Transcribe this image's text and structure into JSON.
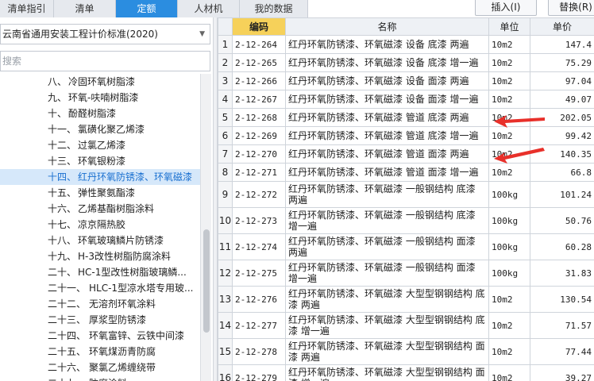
{
  "tabs": [
    {
      "label": "清单指引"
    },
    {
      "label": "清单"
    },
    {
      "label": "定额"
    },
    {
      "label": "人材机"
    },
    {
      "label": "我的数据"
    }
  ],
  "toolbar": {
    "insert_label": "插入(I)",
    "replace_label": "替换(R)"
  },
  "left": {
    "standard": "云南省通用安装工程计价标准(2020)",
    "search_placeholder": "搜索",
    "tree": [
      {
        "num": "八、",
        "label": "冷固环氧树脂漆"
      },
      {
        "num": "九、",
        "label": "环氧-呋喃树脂漆"
      },
      {
        "num": "十、",
        "label": "酚醛树脂漆"
      },
      {
        "num": "十一、",
        "label": "氯磺化聚乙烯漆"
      },
      {
        "num": "十二、",
        "label": "过氯乙烯漆"
      },
      {
        "num": "十三、",
        "label": "环氧银粉漆"
      },
      {
        "num": "十四、",
        "label": "红丹环氧防锈漆、环氧磁漆"
      },
      {
        "num": "十五、",
        "label": "弹性聚氨酯漆"
      },
      {
        "num": "十六、",
        "label": "乙烯基酯树脂涂料"
      },
      {
        "num": "十七、",
        "label": "凉京隔热胶"
      },
      {
        "num": "十八、",
        "label": "环氧玻璃鳞片防锈漆"
      },
      {
        "num": "十九、",
        "label": "H-3改性树脂防腐涂料"
      },
      {
        "num": "二十、",
        "label": "HC-1型改性树脂玻璃鳞..."
      },
      {
        "num": "二十一、",
        "label": "HLC-1型凉水塔专用玻..."
      },
      {
        "num": "二十二、",
        "label": "无溶剂环氧涂料"
      },
      {
        "num": "二十三、",
        "label": "厚浆型防锈漆"
      },
      {
        "num": "二十四、",
        "label": "环氧富锌、云铁中间漆"
      },
      {
        "num": "二十五、",
        "label": "环氧煤沥青防腐"
      },
      {
        "num": "二十六、",
        "label": "聚氯乙烯缠绕带"
      },
      {
        "num": "二十七、",
        "label": "防腐涂料..."
      }
    ]
  },
  "grid": {
    "headers": {
      "code": "编码",
      "name": "名称",
      "unit": "单位",
      "price": "单价"
    },
    "rows": [
      {
        "idx": "1",
        "code": "2-12-264",
        "name": "红丹环氧防锈漆、环氧磁漆 设备 底漆 两遍",
        "unit": "10m2",
        "price": "147.4"
      },
      {
        "idx": "2",
        "code": "2-12-265",
        "name": "红丹环氧防锈漆、环氧磁漆 设备 底漆 增一遍",
        "unit": "10m2",
        "price": "75.29"
      },
      {
        "idx": "3",
        "code": "2-12-266",
        "name": "红丹环氧防锈漆、环氧磁漆 设备 面漆 两遍",
        "unit": "10m2",
        "price": "97.04"
      },
      {
        "idx": "4",
        "code": "2-12-267",
        "name": "红丹环氧防锈漆、环氧磁漆 设备 面漆 增一遍",
        "unit": "10m2",
        "price": "49.07"
      },
      {
        "idx": "5",
        "code": "2-12-268",
        "name": "红丹环氧防锈漆、环氧磁漆 管道 底漆 两遍",
        "unit": "10m2",
        "price": "202.05"
      },
      {
        "idx": "6",
        "code": "2-12-269",
        "name": "红丹环氧防锈漆、环氧磁漆 管道 底漆 增一遍",
        "unit": "10m2",
        "price": "99.42"
      },
      {
        "idx": "7",
        "code": "2-12-270",
        "name": "红丹环氧防锈漆、环氧磁漆 管道 面漆 两遍",
        "unit": "10m2",
        "price": "140.35"
      },
      {
        "idx": "8",
        "code": "2-12-271",
        "name": "红丹环氧防锈漆、环氧磁漆 管道 面漆 增一遍",
        "unit": "10m2",
        "price": "66.8"
      },
      {
        "idx": "9",
        "code": "2-12-272",
        "name": "红丹环氧防锈漆、环氧磁漆 一般钢结构 底漆 两遍",
        "unit": "100kg",
        "price": "101.24"
      },
      {
        "idx": "10",
        "code": "2-12-273",
        "name": "红丹环氧防锈漆、环氧磁漆 一般钢结构 底漆 增一遍",
        "unit": "100kg",
        "price": "50.76"
      },
      {
        "idx": "11",
        "code": "2-12-274",
        "name": "红丹环氧防锈漆、环氧磁漆 一般钢结构 面漆 两遍",
        "unit": "100kg",
        "price": "60.28"
      },
      {
        "idx": "12",
        "code": "2-12-275",
        "name": "红丹环氧防锈漆、环氧磁漆 一般钢结构 面漆 增一遍",
        "unit": "100kg",
        "price": "31.83"
      },
      {
        "idx": "13",
        "code": "2-12-276",
        "name": "红丹环氧防锈漆、环氧磁漆 大型型钢钢结构 底漆 两遍",
        "unit": "10m2",
        "price": "130.54"
      },
      {
        "idx": "14",
        "code": "2-12-277",
        "name": "红丹环氧防锈漆、环氧磁漆 大型型钢钢结构 底漆 增一遍",
        "unit": "10m2",
        "price": "71.57"
      },
      {
        "idx": "15",
        "code": "2-12-278",
        "name": "红丹环氧防锈漆、环氧磁漆 大型型钢钢结构 面漆 两遍",
        "unit": "10m2",
        "price": "77.44"
      },
      {
        "idx": "16",
        "code": "2-12-279",
        "name": "红丹环氧防锈漆、环氧磁漆 大型型钢钢结构 面漆 增一遍",
        "unit": "10m2",
        "price": "39.27"
      }
    ]
  },
  "colors": {
    "accent": "#2b8de0",
    "header_selected": "#f6d15a",
    "annotation": "#e8302a"
  }
}
